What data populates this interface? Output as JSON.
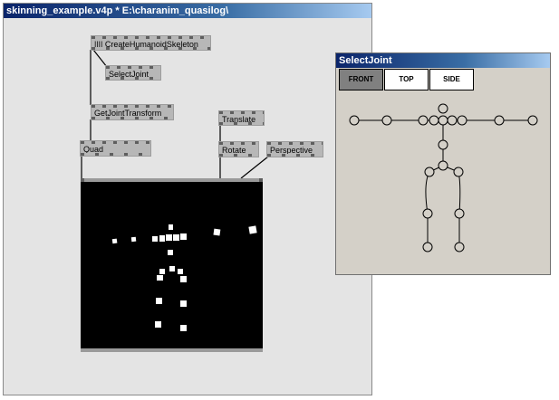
{
  "main_window": {
    "title": "skinning_example.v4p *  E:\\charanim_quasilog\\"
  },
  "nodes": {
    "create_skeleton": "|||| CreateHumanoidSkeleton",
    "select_joint": "SelectJoint",
    "get_joint_transform": "GetJointTransform",
    "translate": "Translate",
    "rotate": "Rotate",
    "perspective": "Perspective",
    "quad": "Quad"
  },
  "select_window": {
    "title": "SelectJoint",
    "tabs": [
      "FRONT",
      "TOP",
      "SIDE"
    ],
    "active_tab": "FRONT"
  },
  "colors": {
    "title_start": "#0a246a",
    "title_end": "#a6caf0",
    "node_fill": "#b7b7b7",
    "canvas_bg": "#000000",
    "panel_bg": "#d4d0c8"
  }
}
